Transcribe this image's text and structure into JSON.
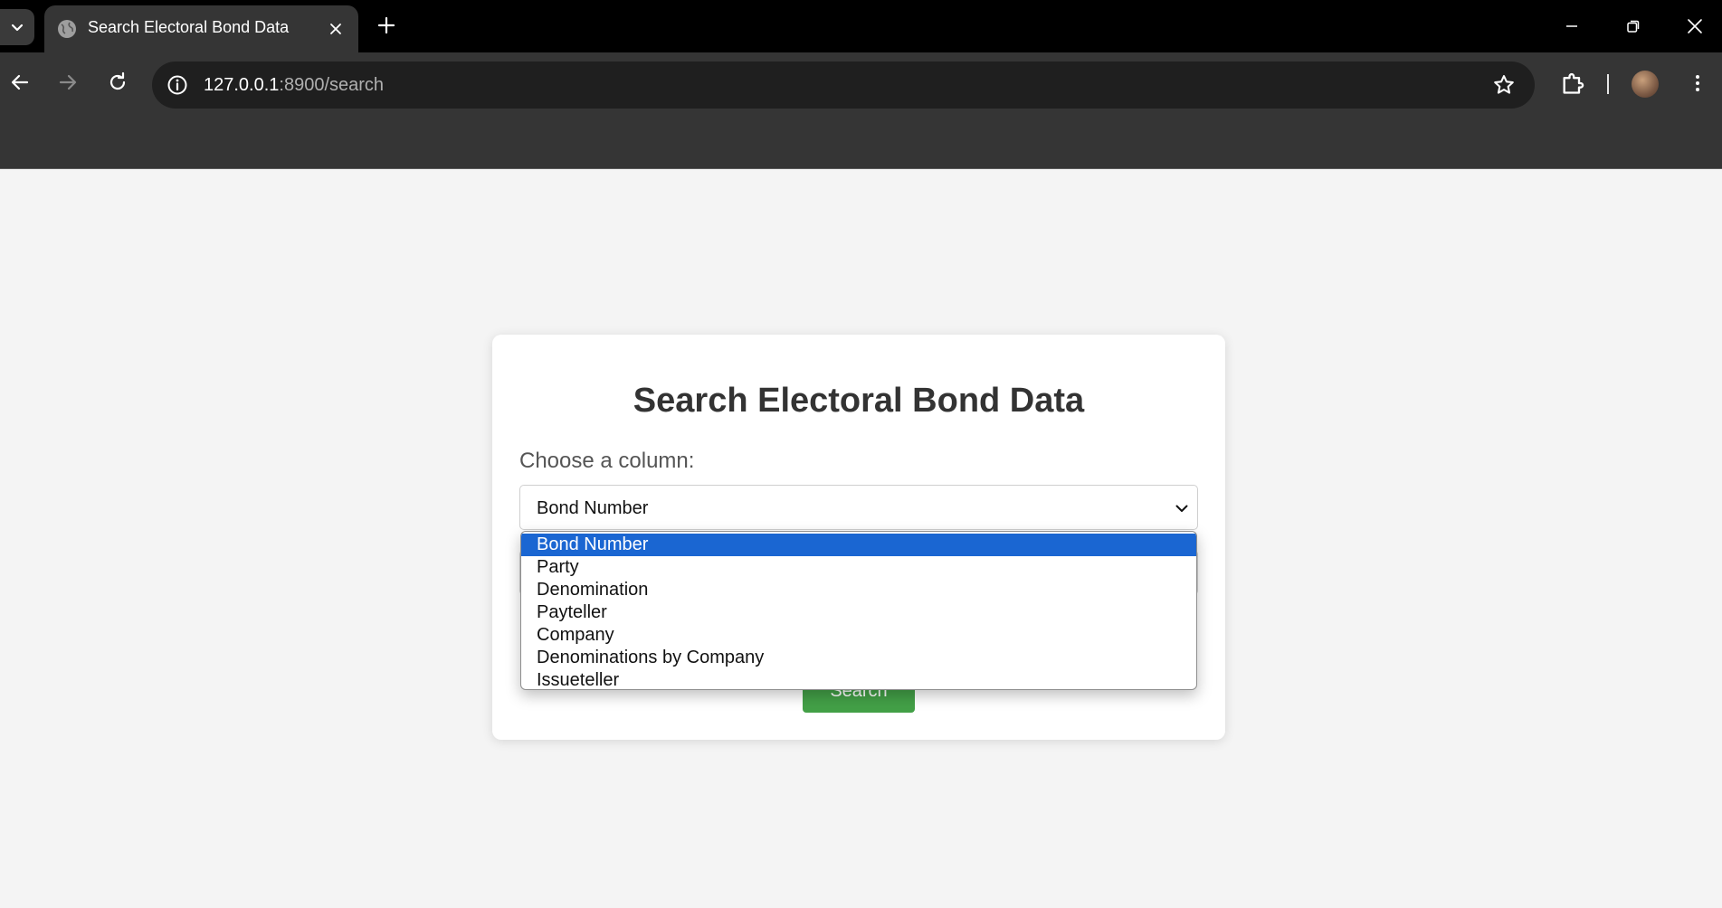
{
  "browser": {
    "tab_title": "Search Electoral Bond Data",
    "url_host": "127.0.0.1",
    "url_path": ":8900/search"
  },
  "page": {
    "title": "Search Electoral Bond Data",
    "column_label": "Choose a column:",
    "selected_column": "Bond Number",
    "search_button": "Search"
  },
  "dropdown": {
    "options": [
      "Bond Number",
      "Party",
      "Denomination",
      "Payteller",
      "Company",
      "Denominations by Company",
      "Issueteller"
    ],
    "highlighted_index": 0
  },
  "colors": {
    "accent_button": "#43a047",
    "option_highlight": "#1a66d2"
  }
}
